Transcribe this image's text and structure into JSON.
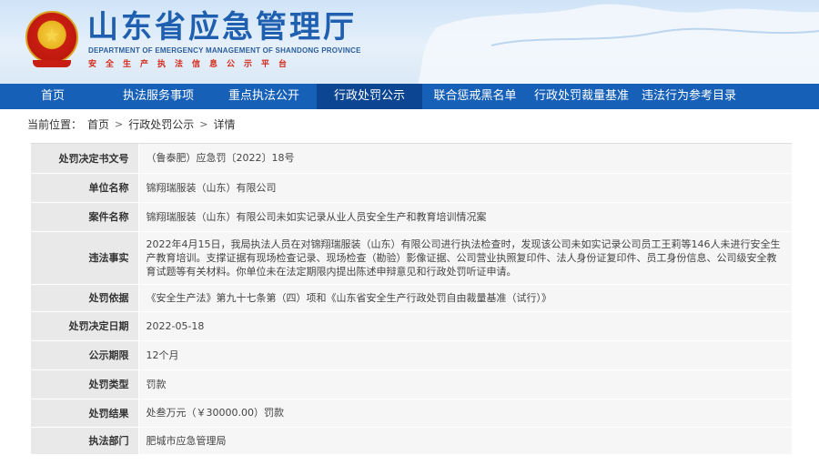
{
  "header": {
    "title": "山东省应急管理厅",
    "subtitle_en": "DEPARTMENT OF EMERGENCY MANAGEMENT OF SHANDONG PROVINCE",
    "subtitle_cn": "安全生产执法信息公示平台",
    "emblem": "national-emblem"
  },
  "nav": {
    "items": [
      {
        "label": "首页"
      },
      {
        "label": "执法服务事项"
      },
      {
        "label": "重点执法公开"
      },
      {
        "label": "行政处罚公示"
      },
      {
        "label": "联合惩戒黑名单"
      },
      {
        "label": "行政处罚裁量基准"
      },
      {
        "label": "违法行为参考目录"
      }
    ],
    "active_index": 3
  },
  "breadcrumb": {
    "prefix": "当前位置：",
    "items": [
      "首页",
      "行政处罚公示",
      "详情"
    ],
    "separator": ">"
  },
  "detail": {
    "rows": [
      {
        "label": "处罚决定书文号",
        "value": "（鲁泰肥）应急罚〔2022〕18号"
      },
      {
        "label": "单位名称",
        "value": "锦翔瑞服装（山东）有限公司"
      },
      {
        "label": "案件名称",
        "value": "锦翔瑞服装（山东）有限公司未如实记录从业人员安全生产和教育培训情况案"
      },
      {
        "label": "违法事实",
        "value": "2022年4月15日，我局执法人员在对锦翔瑞服装（山东）有限公司进行执法检查时，发现该公司未如实记录公司员工王莉等146人未进行安全生产教育培训。支撑证据有现场检查记录、现场检查（勘验）影像证据、公司营业执照复印件、法人身份证复印件、员工身份信息、公司级安全教育试题等有关材料。你单位未在法定期限内提出陈述申辩意见和行政处罚听证申请。"
      },
      {
        "label": "处罚依据",
        "value": "《安全生产法》第九十七条第（四）项和《山东省安全生产行政处罚自由裁量基准（试行）》"
      },
      {
        "label": "处罚决定日期",
        "value": "2022-05-18"
      },
      {
        "label": "公示期限",
        "value": "12个月"
      },
      {
        "label": "处罚类型",
        "value": "罚款"
      },
      {
        "label": "处罚结果",
        "value": "处叁万元（￥30000.00）罚款"
      },
      {
        "label": "执法部门",
        "value": "肥城市应急管理局"
      }
    ]
  },
  "colors": {
    "nav_bg": "#1760b8",
    "nav_active": "#0c4591",
    "title_blue": "#1f5fb0",
    "accent_red": "#d62c1f"
  }
}
